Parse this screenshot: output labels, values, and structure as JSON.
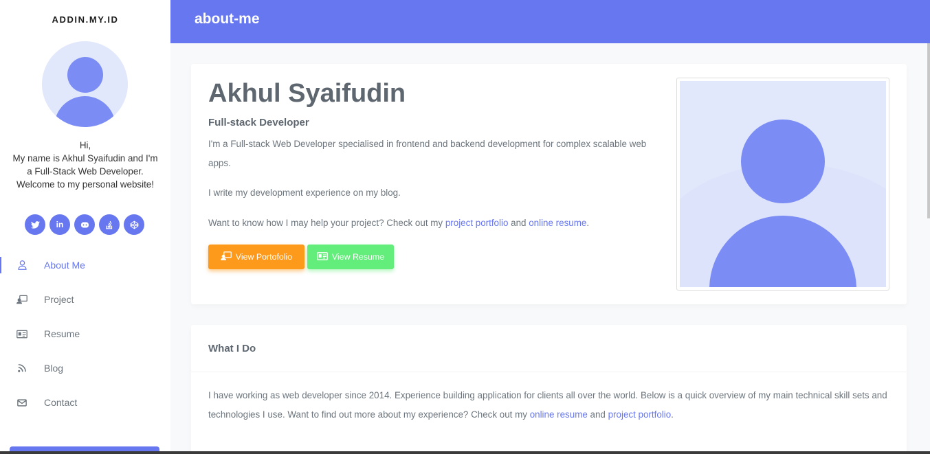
{
  "brand": "ADDIN.MY.ID",
  "sidebar": {
    "intro_greeting": "Hi,",
    "intro_text": "My name is Akhul Syaifudin and I'm a Full-Stack Web Developer. Welcome to my personal website!",
    "social": [
      "twitter-icon",
      "linkedin-icon",
      "github-icon",
      "stackoverflow-icon",
      "codepen-icon"
    ],
    "nav": [
      {
        "label": "About Me",
        "icon": "user-icon",
        "active": true
      },
      {
        "label": "Project",
        "icon": "project-icon",
        "active": false
      },
      {
        "label": "Resume",
        "icon": "id-card-icon",
        "active": false
      },
      {
        "label": "Blog",
        "icon": "rss-icon",
        "active": false
      },
      {
        "label": "Contact",
        "icon": "envelope-icon",
        "active": false
      }
    ]
  },
  "header": {
    "title": "about-me"
  },
  "profile": {
    "name": "Akhul Syaifudin",
    "role": "Full-stack Developer",
    "para1": "I'm a Full-stack Web Developer specialised in frontend and backend development for complex scalable web apps.",
    "para2": "I write my development experience on my blog.",
    "para3_prefix": "Want to know how I may help your project? Check out my ",
    "para3_link1": "project portfolio",
    "para3_mid": " and ",
    "para3_link2": "online resume",
    "para3_suffix": ".",
    "btn_portfolio": "View Portofolio",
    "btn_resume": "View Resume"
  },
  "what_i_do": {
    "title": "What I Do",
    "text_prefix": "I have working as web developer since 2014. Experience building application for clients all over the world. Below is a quick overview of my main technical skill sets and technologies I use. Want to find out more about my experience? Check out my ",
    "link1": "online resume",
    "mid": " and ",
    "link2": "project portfolio",
    "suffix": "."
  },
  "colors": {
    "primary": "#6777ef",
    "warning": "#fd9a1b",
    "success": "#63ed7a",
    "avatar_bg": "#e1e8fc",
    "avatar_fg": "#7b8cf4"
  }
}
